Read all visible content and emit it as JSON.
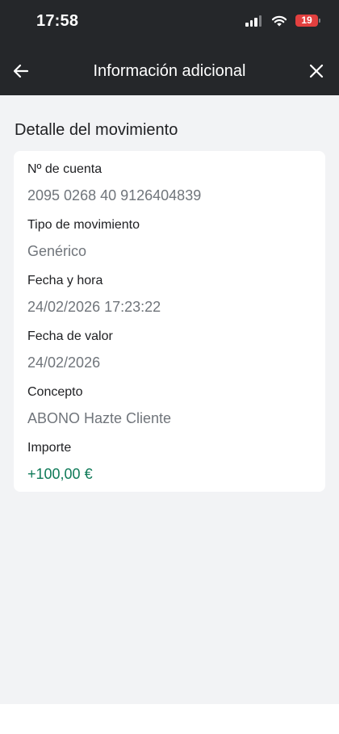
{
  "status_bar": {
    "time": "17:58",
    "battery_level": "19"
  },
  "header": {
    "title": "Información adicional"
  },
  "section": {
    "title": "Detalle del movimiento"
  },
  "details": [
    {
      "label": "Nº de cuenta",
      "value": "2095 0268 40 9126404839"
    },
    {
      "label": "Tipo de movimiento",
      "value": "Genérico"
    },
    {
      "label": "Fecha y hora",
      "value": "24/02/2026 17:23:22"
    },
    {
      "label": "Fecha de valor",
      "value": "24/02/2026"
    },
    {
      "label": "Concepto",
      "value": "ABONO Hazte Cliente"
    },
    {
      "label": "Importe",
      "value": "+100,00 €"
    }
  ],
  "colors": {
    "header_background": "#25272a",
    "page_background": "#f2f3f5",
    "amount_positive": "#0f7a58",
    "battery_low": "#e2403f"
  },
  "icons": {
    "back": "arrow-left-icon",
    "close": "close-icon",
    "signal": "cellular-signal-icon",
    "wifi": "wifi-icon",
    "battery": "battery-icon"
  }
}
